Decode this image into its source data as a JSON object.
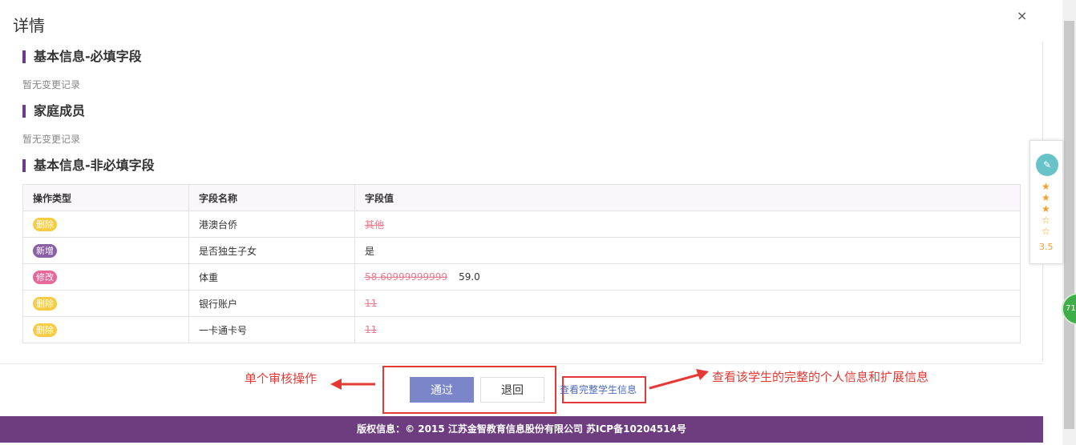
{
  "modal": {
    "title": "详情",
    "close_label": "×"
  },
  "sections": {
    "required": {
      "title": "基本信息-必填字段",
      "empty_text": "暂无变更记录"
    },
    "family": {
      "title": "家庭成员",
      "empty_text": "暂无变更记录"
    },
    "optional": {
      "title": "基本信息-非必填字段"
    }
  },
  "table": {
    "headers": [
      "操作类型",
      "字段名称",
      "字段值"
    ],
    "rows": [
      {
        "op": "删除",
        "op_type": "delete",
        "field": "港澳台侨",
        "old_value": "其他",
        "new_value": ""
      },
      {
        "op": "新增",
        "op_type": "add",
        "field": "是否独生子女",
        "old_value": "",
        "new_value": "是"
      },
      {
        "op": "修改",
        "op_type": "modify",
        "field": "体重",
        "old_value": "58.60999999999",
        "new_value": "59.0"
      },
      {
        "op": "删除",
        "op_type": "delete",
        "field": "银行账户",
        "old_value": "11",
        "new_value": ""
      },
      {
        "op": "删除",
        "op_type": "delete",
        "field": "一卡通卡号",
        "old_value": "11",
        "new_value": ""
      }
    ]
  },
  "actions": {
    "pass_label": "通过",
    "back_label": "退回",
    "view_full_label": "查看完整学生信息"
  },
  "annotations": {
    "left": "单个审核操作",
    "right": "查看该学生的完整的个人信息和扩展信息"
  },
  "footer": {
    "copyright": "版权信息：© 2015 江苏金智教育信息股份有限公司 苏ICP备10204514号"
  },
  "rating": {
    "stars_filled": 3,
    "stars_total": 5,
    "score": "3.5",
    "star_filled": "★",
    "star_empty": "☆"
  },
  "badge": {
    "text": "71"
  },
  "colors": {
    "accent": "#6e3d80",
    "pass_button": "#7a86c9",
    "annotation_red": "#e53935"
  }
}
